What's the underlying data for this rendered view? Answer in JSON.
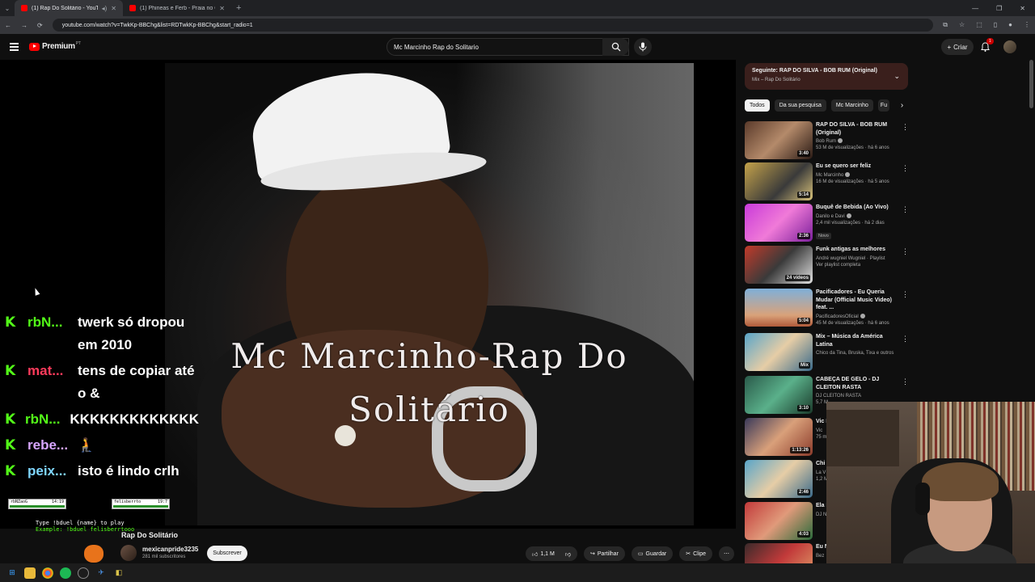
{
  "browser": {
    "tabs": [
      {
        "title": "(1) Rap Do Solitário - YouTube",
        "active": true
      },
      {
        "title": "(1) Phineas e Ferb - Praia no Ci...",
        "active": false
      }
    ],
    "url": "youtube.com/watch?v=TwkKp-BBChg&list=RDTwkKp-BBChg&start_radio=1"
  },
  "header": {
    "logo": "Premium",
    "region": "PT",
    "search_value": "Mc Marcinho Rap do Solitario",
    "create_label": "Criar",
    "notif_count": "1"
  },
  "video": {
    "overlay_line1": "Mc Marcinho-Rap Do",
    "overlay_line2": "Solitário",
    "title": "Rap Do Solitário",
    "channel": "mexicanpride3235",
    "subs": "281 mil subscritores",
    "subscribe_label": "Subscrever",
    "likes": "1,1 M",
    "share_label": "Partilhar",
    "save_label": "Guardar",
    "clip_label": "Clipe"
  },
  "chat": [
    {
      "user": "rbN...",
      "msg": "twerk só dropou em 2010",
      "color": "#53fc18"
    },
    {
      "user": "mat...",
      "msg": "tens de copiar até o &",
      "color": "#ff3b5c"
    },
    {
      "user": "rbN...",
      "msg": "KKKKKKKKKKKKK",
      "color": "#53fc18"
    },
    {
      "user": "rebe...",
      "msg": "🧎",
      "color": "#d7a6ff"
    },
    {
      "user": "peix...",
      "msg": "isto é lindo crlh",
      "color": "#7fd6ff"
    }
  ],
  "duel": {
    "left_name": "rbNZaoG",
    "left_score": "14:19",
    "right_name": "felisberrto",
    "right_score": "19:7",
    "line1": "Type !bduel {name} to play",
    "line2": "Example: !bduel felisberrtooo"
  },
  "sidebar": {
    "next_title": "Seguinte: RAP DO SILVA - BOB RUM (Original)",
    "next_sub": "Mix – Rap Do Solitário",
    "chips": [
      "Todos",
      "Da sua pesquisa",
      "Mc Marcinho",
      "Fu"
    ],
    "items": [
      {
        "title": "RAP DO SILVA - BOB RUM (Original)",
        "channel": "Bob Rum",
        "meta": "53 M de visualizações · há 6 anos",
        "duration": "3:40",
        "verified": true
      },
      {
        "title": "Eu se quero ser feliz",
        "channel": "Mc Marcinho",
        "meta": "16 M de visualizações · há 5 anos",
        "duration": "5:14",
        "verified": true
      },
      {
        "title": "Buquê de Bebida (Ao Vivo)",
        "channel": "Danilo e Davi",
        "meta": "2,4 mil visualizações · há 2 dias",
        "duration": "2:36",
        "verified": true,
        "badge": "Novo"
      },
      {
        "title": "Funk antigas as melhores",
        "channel": "André wugniel Wugniel · Playlist",
        "meta": "Ver playlist completa",
        "duration": "24 vídeos",
        "verified": false
      },
      {
        "title": "Pacificadores - Eu Queria Mudar (Official Music Video) feat. ...",
        "channel": "PacificadoresOficial",
        "meta": "45 M de visualizações · há 6 anos",
        "duration": "5:04",
        "verified": true
      },
      {
        "title": "Mix – Música da América Latina",
        "channel": "Chico da Tina, Bruska, Tixa e outros",
        "meta": "",
        "duration": "Mix",
        "verified": false
      },
      {
        "title": "CABEÇA DE GELO - DJ CLEITON RASTA",
        "channel": "DJ CLEITON RASTA",
        "meta": "5,7 M",
        "duration": "3:10",
        "verified": false
      },
      {
        "title": "Vic Lisb",
        "channel": "Vic",
        "meta": "75 m",
        "duration": "1:13:26",
        "verified": false
      },
      {
        "title": "Chi Últi",
        "channel": "La V",
        "meta": "1,2 M",
        "duration": "2:46",
        "verified": false
      },
      {
        "title": "Ela Dan",
        "channel": "DJ N",
        "meta": "",
        "duration": "4:03",
        "verified": false
      },
      {
        "title": "Eu N",
        "channel": "Bez",
        "meta": "",
        "duration": "",
        "verified": false
      }
    ]
  },
  "icons": {
    "kick": "K",
    "search": "search-icon",
    "mic": "mic-icon"
  }
}
